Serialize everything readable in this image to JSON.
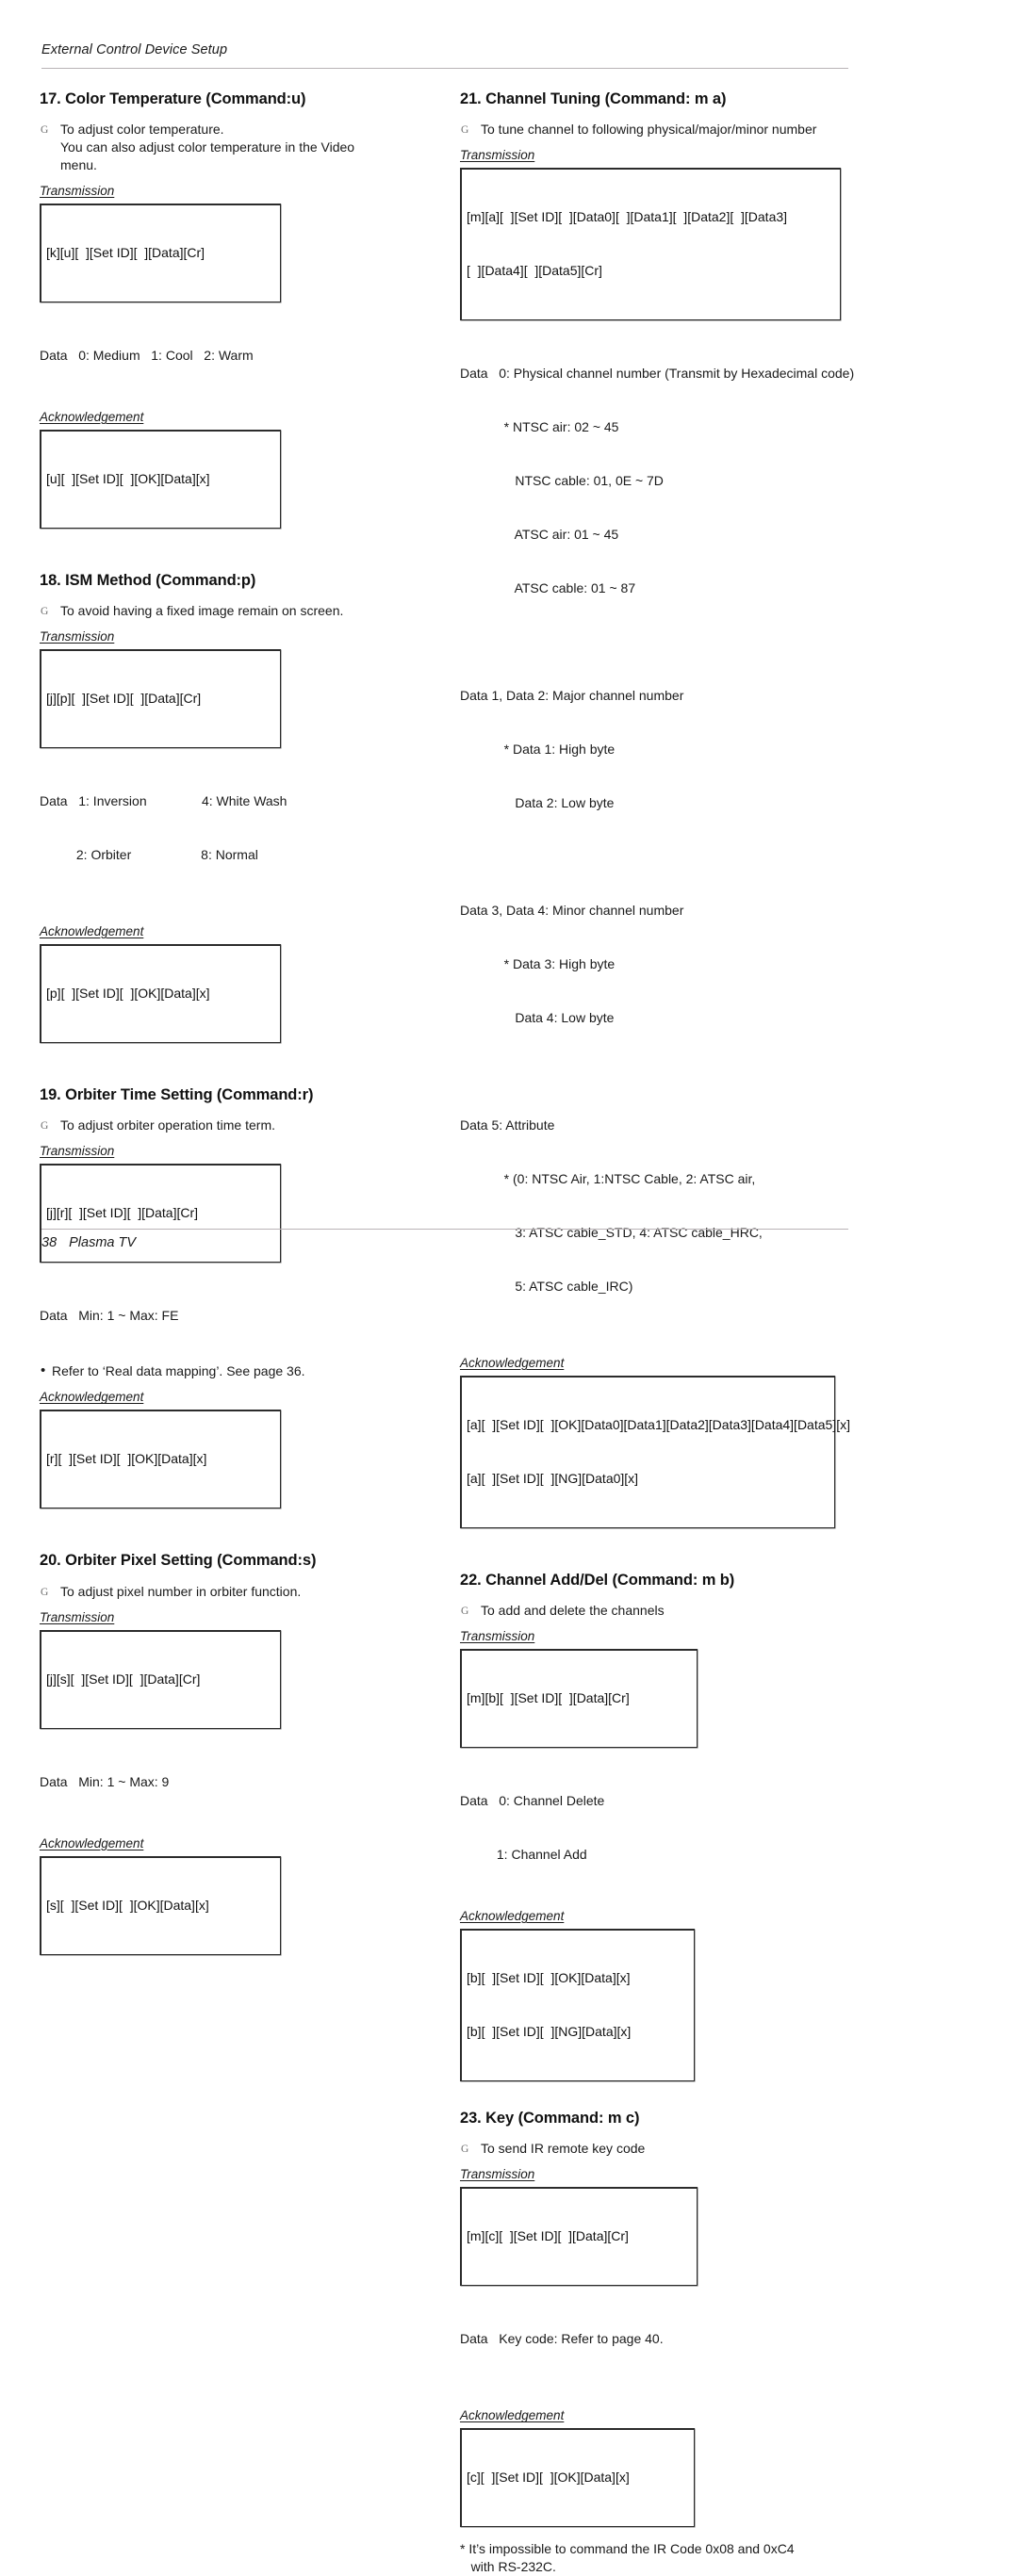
{
  "header": {
    "running_title": "External Control Device Setup"
  },
  "footer": {
    "page_number": "38",
    "product": "Plasma TV"
  },
  "labels": {
    "transmission": "Transmission",
    "acknowledgement": "Acknowledgement",
    "data": "Data",
    "bullet_g": "G",
    "bullet_dot": "•"
  },
  "left_column": [
    {
      "title": "17. Color Temperature (Command:u)",
      "desc_line1": "To adjust color temperature.",
      "desc_line2": "You can also adjust color temperature in the Video",
      "desc_line3": "menu.",
      "transmission_label": "Transmission",
      "transmission_cmd": "[k][u][  ][Set ID][  ][Data][Cr]",
      "data_rows": [
        "Data   0: Medium   1: Cool   2: Warm"
      ],
      "ack_label": "Acknowledgement",
      "ack_cmd": "[u][  ][Set ID][  ][OK][Data][x]"
    },
    {
      "title": "18. ISM Method (Command:p)",
      "desc_line1": "To avoid having a fixed image remain on screen.",
      "transmission_label": "Transmission",
      "transmission_cmd": "[j][p][  ][Set ID][  ][Data][Cr]",
      "data_rows": [
        "Data   1: Inversion               4: White Wash",
        "          2: Orbiter                   8: Normal"
      ],
      "ack_label": "Acknowledgement",
      "ack_cmd": "[p][  ][Set ID][  ][OK][Data][x]"
    },
    {
      "title": "19. Orbiter Time Setting (Command:r)",
      "desc_line1": "To adjust orbiter operation time term.",
      "transmission_label": "Transmission",
      "transmission_cmd": "[j][r][  ][Set ID][  ][Data][Cr]",
      "data_rows": [
        "Data   Min: 1 ~ Max: FE"
      ],
      "note": "Refer to ‘Real data mapping’. See page 36.",
      "ack_label": "Acknowledgement",
      "ack_cmd": "[r][  ][Set ID][  ][OK][Data][x]"
    },
    {
      "title": "20. Orbiter Pixel Setting (Command:s)",
      "desc_line1": "To adjust pixel number in orbiter function.",
      "transmission_label": "Transmission",
      "transmission_cmd": "[j][s][  ][Set ID][  ][Data][Cr]",
      "data_rows": [
        "Data   Min: 1 ~ Max: 9"
      ],
      "ack_label": "Acknowledgement",
      "ack_cmd": "[s][  ][Set ID][  ][OK][Data][x]"
    }
  ],
  "right_column": [
    {
      "title": "21. Channel Tuning (Command: m a)",
      "desc_line1": "To tune channel to following physical/major/minor number",
      "transmission_label": "Transmission",
      "transmission_cmd_line1": "[m][a][  ][Set ID][  ][Data0][  ][Data1][  ][Data2][  ][Data3]",
      "transmission_cmd_line2": "[  ][Data4][  ][Data5][Cr]",
      "data_rows": [
        "Data   0: Physical channel number (Transmit by Hexadecimal code)",
        "            * NTSC air: 02 ~ 45",
        "               NTSC cable: 01, 0E ~ 7D",
        "               ATSC air: 01 ~ 45",
        "               ATSC cable: 01 ~ 87",
        "",
        "Data 1, Data 2: Major channel number",
        "            * Data 1: High byte",
        "               Data 2: Low byte",
        "",
        "Data 3, Data 4: Minor channel number",
        "            * Data 3: High byte",
        "               Data 4: Low byte",
        "",
        "Data 5: Attribute",
        "            * (0: NTSC Air, 1:NTSC Cable, 2: ATSC air,",
        "               3: ATSC cable_STD, 4: ATSC cable_HRC,",
        "               5: ATSC cable_IRC)"
      ],
      "ack_label": "Acknowledgement",
      "ack_cmd_line1": "[a][  ][Set ID][  ][OK][Data0][Data1][Data2][Data3][Data4][Data5][x]",
      "ack_cmd_line2": "[a][  ][Set ID][  ][NG][Data0][x]"
    },
    {
      "title": "22. Channel Add/Del (Command: m b)",
      "desc_line1": "To add and delete the channels",
      "transmission_label": "Transmission",
      "transmission_cmd": "[m][b][  ][Set ID][  ][Data][Cr]",
      "data_rows": [
        "Data   0: Channel Delete",
        "          1: Channel Add"
      ],
      "ack_label": "Acknowledgement",
      "ack_cmd_line1": "[b][  ][Set ID][  ][OK][Data][x]",
      "ack_cmd_line2": "[b][  ][Set ID][  ][NG][Data][x]"
    },
    {
      "title": "23. Key (Command: m c)",
      "desc_line1": "To send IR remote key code",
      "transmission_label": "Transmission",
      "transmission_cmd": "[m][c][  ][Set ID][  ][Data][Cr]",
      "data_rows": [
        "Data   Key code: Refer to page 40."
      ],
      "ack_label": "Acknowledgement",
      "ack_cmd": "[c][  ][Set ID][  ][OK][Data][x]",
      "tail_note": "* It’s impossible to command the IR Code 0x08 and 0xC4\n   with RS-232C."
    }
  ]
}
